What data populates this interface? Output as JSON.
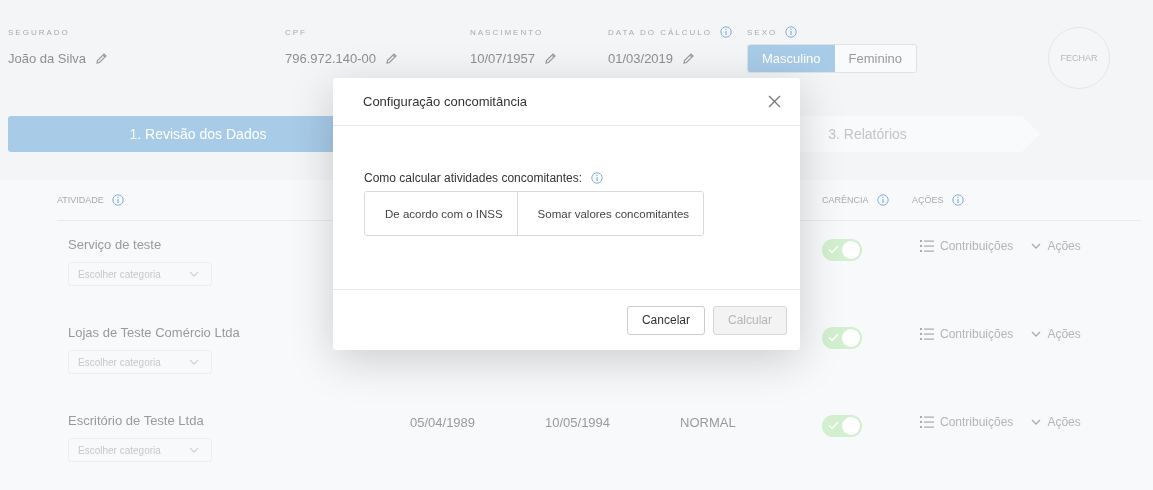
{
  "header": {
    "fields": [
      {
        "label": "SEGURADO",
        "value": "João da Silva",
        "info": false
      },
      {
        "label": "CPF",
        "value": "796.972.140-00",
        "info": false
      },
      {
        "label": "NASCIMENTO",
        "value": "10/07/1957",
        "info": false
      },
      {
        "label": "DATA DO CÁLCULO",
        "value": "01/03/2019",
        "info": true
      }
    ],
    "sex": {
      "label": "SEXO",
      "info": true,
      "options": [
        {
          "label": "Masculino",
          "selected": true
        },
        {
          "label": "Feminino",
          "selected": false
        }
      ]
    },
    "close_button": "FECHAR"
  },
  "steps": [
    {
      "label": "1. Revisão dos Dados",
      "selected": true
    },
    {
      "label": "3. Relatórios",
      "selected": false
    }
  ],
  "table": {
    "columns": [
      {
        "label": "ATIVIDADE",
        "info": true
      },
      {
        "label": "CARÊNCIA",
        "info": true
      },
      {
        "label": "AÇÕES",
        "info": true
      }
    ],
    "rows": [
      {
        "name": "Serviço de teste",
        "category_placeholder": "Escolher categoria",
        "carencia_on": true,
        "contributions": "Contribuições",
        "actions": "Ações"
      },
      {
        "name": "Lojas de Teste Comércio Ltda",
        "category_placeholder": "Escolher categoria",
        "carencia_on": true,
        "contributions": "Contribuições",
        "actions": "Ações"
      },
      {
        "name": "Escritório de Teste Ltda",
        "category_placeholder": "Escolher categoria",
        "start": "05/04/1989",
        "end": "10/05/1994",
        "type": "NORMAL",
        "carencia_on": true,
        "contributions": "Contribuições",
        "actions": "Ações"
      }
    ]
  },
  "modal": {
    "title": "Configuração concomitância",
    "question": "Como calcular atividades concomitantes:",
    "options": [
      {
        "label": "De acordo com o INSS",
        "selected": false
      },
      {
        "label": "Somar valores concomitantes",
        "selected": false
      }
    ],
    "buttons": [
      {
        "label": "Cancelar",
        "disabled": false
      },
      {
        "label": "Calcular",
        "disabled": true
      }
    ]
  }
}
